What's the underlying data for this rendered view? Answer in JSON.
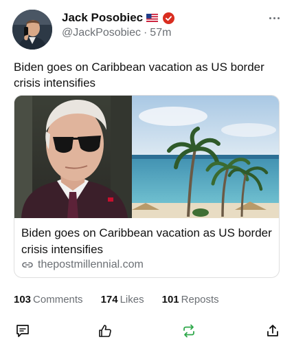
{
  "author": {
    "name": "Jack Posobiec",
    "handle": "@JackPosobiec",
    "separator": "·",
    "time": "57m"
  },
  "post": {
    "text": "Biden goes on Caribbean vacation as US border crisis intensifies"
  },
  "card": {
    "title": "Biden goes on Caribbean vacation as US border crisis intensifies",
    "domain": "thepostmillennial.com"
  },
  "stats": {
    "comments_count": "103",
    "comments_label": "Comments",
    "likes_count": "174",
    "likes_label": "Likes",
    "reposts_count": "101",
    "reposts_label": "Reposts"
  },
  "icons": {
    "flag": "us-flag-icon",
    "badge": "verified-badge-icon",
    "more": "more-icon",
    "link": "link-icon",
    "comment": "comment-icon",
    "like": "thumbs-up-icon",
    "repost": "repost-icon",
    "share": "share-icon"
  },
  "colors": {
    "badge_red": "#d92d20",
    "repost_green": "#2ea84a",
    "secondary_text": "#6b6f74"
  }
}
